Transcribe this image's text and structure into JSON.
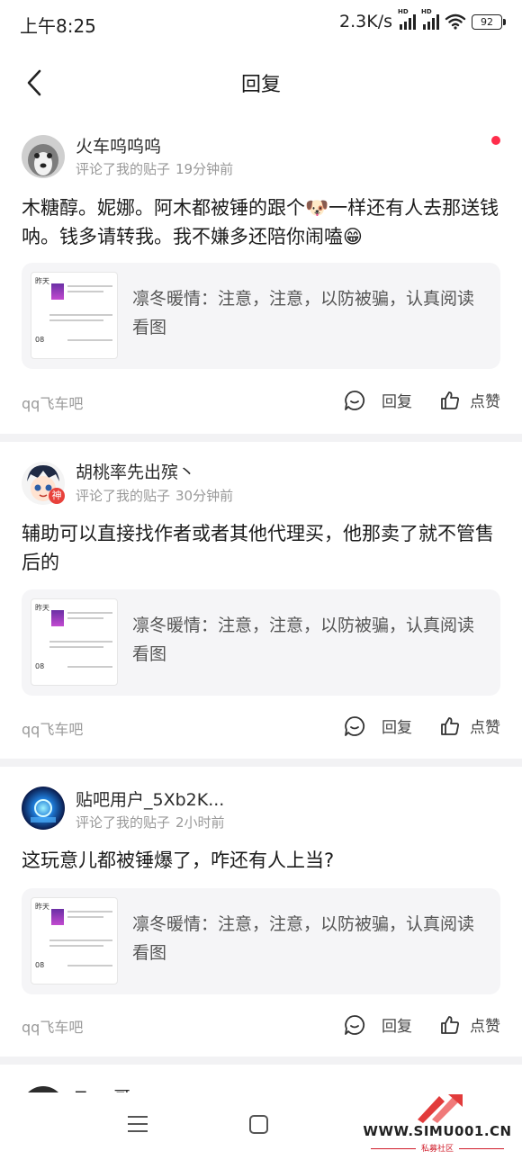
{
  "status_bar": {
    "time": "上午8:25",
    "speed": "2.3K/s",
    "hd": "HD",
    "battery": "92"
  },
  "header": {
    "title": "回复"
  },
  "replies": [
    {
      "username": "火车呜呜呜",
      "action": "评论了我的贴子",
      "time": "19分钟前",
      "unread": true,
      "content": "木糖醇。妮娜。阿木都被锤的跟个🐶一样还有人去那送钱呐。钱多请转我。我不嫌多还陪你闹嗑😁",
      "quote": "凛冬暖情：注意，注意，以防被骗，认真阅读看图",
      "forum": "qq飞车吧",
      "reply_label": "回复",
      "like_label": "点赞"
    },
    {
      "username": "胡桃率先出殡丶",
      "badge": "神",
      "action": "评论了我的贴子",
      "time": "30分钟前",
      "unread": false,
      "content": "辅助可以直接找作者或者其他代理买，他那卖了就不管售后的",
      "quote": "凛冬暖情：注意，注意，以防被骗，认真阅读看图",
      "forum": "qq飞车吧",
      "reply_label": "回复",
      "like_label": "点赞"
    },
    {
      "username": "贴吧用户_5Xb2K...",
      "action": "评论了我的贴子",
      "time": "2小时前",
      "unread": false,
      "content": "这玩意儿都被锤爆了，咋还有人上当?",
      "quote": "凛冬暖情：注意，注意，以防被骗，认真阅读看图",
      "forum": "qq飞车吧",
      "reply_label": "回复",
      "like_label": "点赞"
    }
  ],
  "quote_thumb": {
    "line1": "昨天",
    "line2": "08"
  },
  "next_reply": {
    "username": "Taco哥"
  },
  "watermark": {
    "site": "WWW.SIMU001.CN",
    "sub": "私募社区"
  },
  "colors": {
    "unread_dot": "#ff2d4b",
    "divider": "#f2f2f4",
    "quote_bg": "#f5f5f7"
  }
}
